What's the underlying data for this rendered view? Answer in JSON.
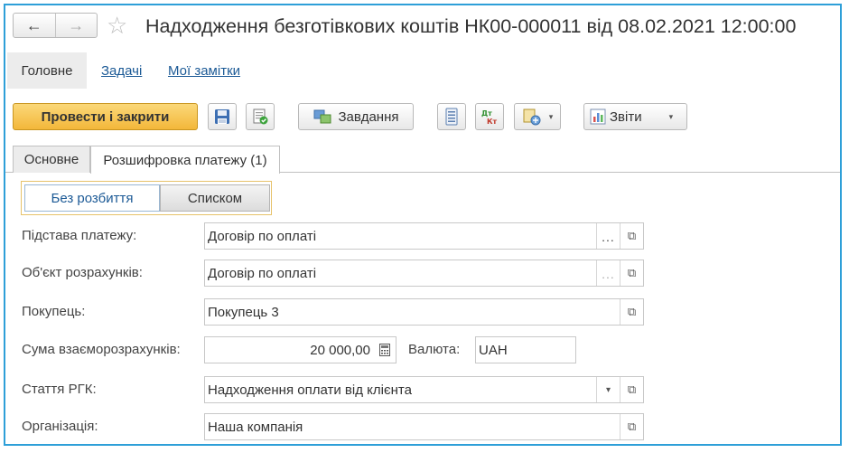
{
  "header": {
    "back_icon": "arrow-left-icon",
    "forward_icon": "arrow-right-icon",
    "favorite_icon": "star-icon",
    "title": "Надходження безготівкових коштів НК00-000011 від 08.02.2021 12:00:00"
  },
  "sections": {
    "main": "Головне",
    "tasks": "Задачі",
    "notes": "Мої замітки"
  },
  "toolbar": {
    "post_and_close": "Провести і закрити",
    "task": "Завдання",
    "reports": "Звіти"
  },
  "tabs": [
    {
      "label": "Основне"
    },
    {
      "label": "Розшифровка платежу (1)"
    }
  ],
  "breakdown_mode": {
    "options": [
      "Без розбиття",
      "Списком"
    ],
    "selected": "Без розбиття"
  },
  "form": {
    "payment_basis": {
      "label": "Підстава платежу:",
      "value": "Договір по оплаті"
    },
    "settlement_object": {
      "label": "Об'єкт розрахунків:",
      "value": "Договір по оплаті"
    },
    "buyer": {
      "label": "Покупець:",
      "value": "Покупець 3"
    },
    "settlement_amount": {
      "label": "Сума взаєморозрахунків:",
      "value": "20 000,00"
    },
    "currency": {
      "label": "Валюта:",
      "value": "UAH"
    },
    "rgk_item": {
      "label": "Стаття РГК:",
      "value": "Надходження оплати від клієнта"
    },
    "organization": {
      "label": "Організація:",
      "value": "Наша компанія"
    }
  },
  "colors": {
    "accent_border": "#2e9fd8",
    "primary_button": "#f3b73a",
    "link": "#1c5a96"
  }
}
